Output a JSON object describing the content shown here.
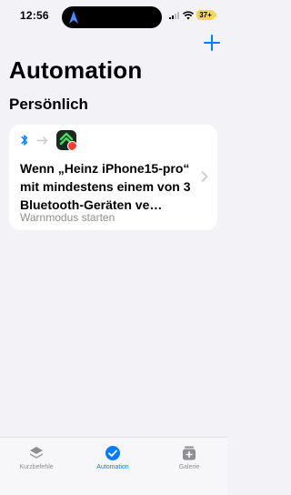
{
  "status_bar": {
    "time": "12:56",
    "battery": "37+"
  },
  "header": {
    "title": "Automation",
    "add_icon": "plus-icon"
  },
  "section": {
    "title": "Persönlich"
  },
  "automations": [
    {
      "title": "Wenn „Heinz iPhone15-pro“ mit mindestens einem von 3 Bluetooth-Geräten ve…",
      "subtitle": "Warnmodus starten",
      "trigger_icon": "bluetooth-icon",
      "app_icon": "warnmodus-app-icon"
    }
  ],
  "tabbar": {
    "items": [
      {
        "label": "Kurzbefehle",
        "icon": "layers-icon"
      },
      {
        "label": "Automation",
        "icon": "checkmark-clock-icon",
        "active": true
      },
      {
        "label": "Galerie",
        "icon": "gallery-add-icon"
      }
    ]
  },
  "colors": {
    "accent": "#0a7aff",
    "background": "#f2f2f7",
    "battery": "#f4d35e"
  }
}
